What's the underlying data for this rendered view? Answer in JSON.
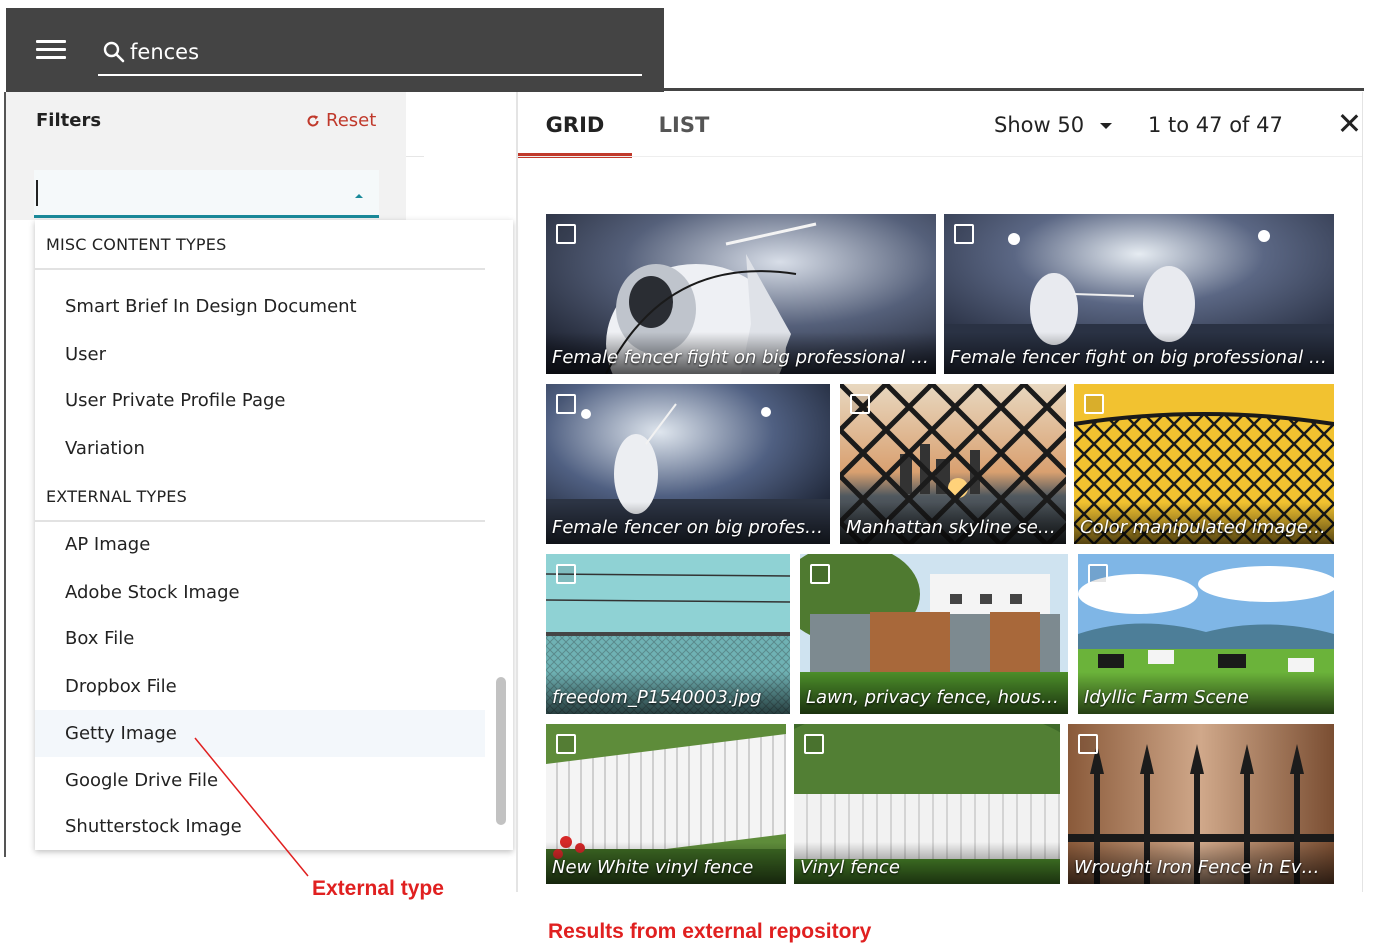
{
  "search": {
    "value": "fences",
    "icon": "search-icon"
  },
  "menu": {
    "icon": "hamburger-menu-icon"
  },
  "filters": {
    "title": "Filters",
    "reset_label": "Reset",
    "reset_icon": "refresh-icon",
    "type_value": ""
  },
  "dropdown": {
    "sections": [
      {
        "header": "MISC CONTENT TYPES",
        "items": [
          "Smart Brief In Design Document",
          "User",
          "User Private Profile Page",
          "Variation"
        ]
      },
      {
        "header": "EXTERNAL TYPES",
        "items": [
          "AP Image",
          "Adobe Stock Image",
          "Box File",
          "Dropbox File",
          "Getty Image",
          "Google Drive File",
          "Shutterstock Image"
        ]
      }
    ],
    "hovered_item": "Getty Image"
  },
  "view_tabs": {
    "grid": "GRID",
    "list": "LIST",
    "active": "GRID"
  },
  "show": {
    "label": "Show 50"
  },
  "pager": {
    "text": "1 to 47 of 47"
  },
  "results": [
    {
      "caption": "Female fencer fight on big professional arena"
    },
    {
      "caption": "Female fencer fight on big professional arena"
    },
    {
      "caption": "Female fencer on big professional arena"
    },
    {
      "caption": "Manhattan skyline seen through fence"
    },
    {
      "caption": "Color manipulated image of fence"
    },
    {
      "caption": "freedom_P1540003.jpg"
    },
    {
      "caption": "Lawn, privacy fence, house and garden"
    },
    {
      "caption": "Idyllic Farm Scene"
    },
    {
      "caption": "New White vinyl fence"
    },
    {
      "caption": "Vinyl fence"
    },
    {
      "caption": "Wrought Iron Fence in Evening"
    }
  ],
  "annotations": {
    "external_type": "External type",
    "results_external": "Results from external repository"
  },
  "colors": {
    "topbar": "#444444",
    "accent": "#c0392b",
    "select_underline": "#1a8a9a",
    "annotation": "#e02020"
  }
}
